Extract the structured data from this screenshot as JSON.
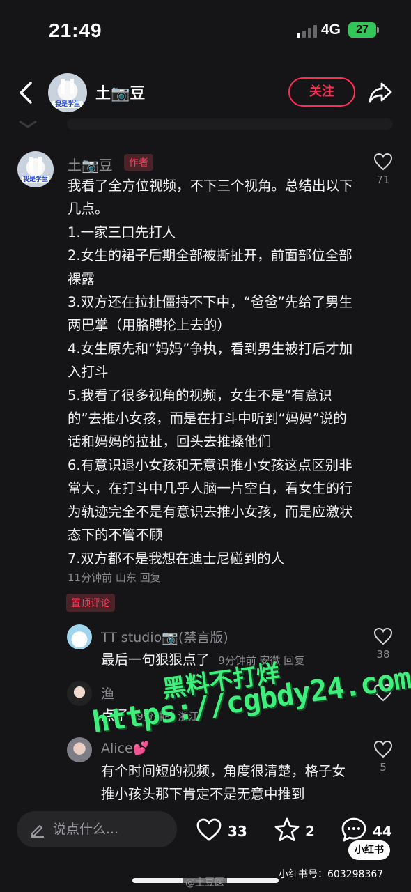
{
  "status_bar": {
    "time": "21:49",
    "network": "4G",
    "battery": "27"
  },
  "header": {
    "avatar_label": "我是学生",
    "name": "土📷豆",
    "follow_label": "关注"
  },
  "main_comment": {
    "avatar_label": "我是学生",
    "name": "土📷豆",
    "author_tag": "作者",
    "body": "我看了全方位视频，不下三个视角。总结出以下几点。\n1.一家三口先打人\n2.女生的裙子后期全部被撕扯开，前面部位全部裸露\n3.双方还在拉扯僵持不下中，“爸爸”先给了男生两巴掌（用胳膊抡上去的）\n4.女生原先和“妈妈”争执，看到男生被打后才加入打斗\n5.我看了很多视角的视频，女生不是“有意识的”去推小女孩，而是在打斗中听到“妈妈”说的话和妈妈的拉扯，回头去推搡他们\n6.有意识退小女孩和无意识推小女孩这点区别非常大，在打斗中几乎人脑一片空白，看女生的行为轨迹完全不是有意识去推小女孩，而是应激状态下的不管不顾\n7.双方都不是我想在迪士尼碰到的人",
    "meta": "11分钟前 山东 回复",
    "like_count": "71"
  },
  "pin_tag": "置顶评论",
  "replies": [
    {
      "name": "TT studio📷(禁言版)",
      "body": "最后一句狠狠点了",
      "meta": "9分钟前 安徽 回复",
      "like_count": "38"
    },
    {
      "name": "渔",
      "body": "点了",
      "meta": "9分钟前 浙江",
      "like_count": ""
    },
    {
      "name": "Alice💕",
      "body": "有个时间短的视频，角度很清楚，格子女推小孩头那下肯定不是无意中推到",
      "meta": "",
      "like_count": "5"
    }
  ],
  "watermark": {
    "line1": "黑料不打烊",
    "line2": "https://cgbdy24.com"
  },
  "bottom_bar": {
    "input_placeholder": "说点什么...",
    "likes": "33",
    "favorites": "2",
    "comments": "44",
    "logo": "小红书",
    "xhs_id": "小红书号：603298367",
    "weibo_tag": "@土豆医"
  }
}
